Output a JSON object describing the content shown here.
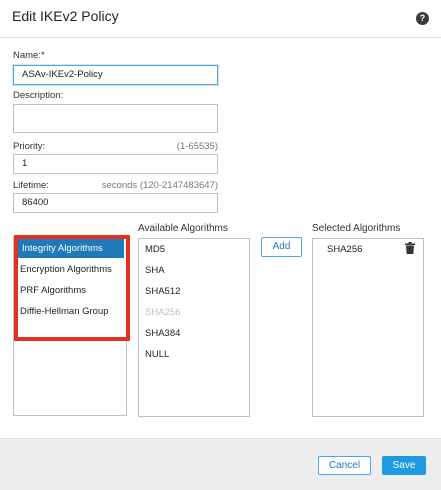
{
  "dialog": {
    "title": "Edit IKEv2 Policy",
    "help_icon_glyph": "?"
  },
  "form": {
    "name_label": "Name:*",
    "name_value": "ASAv-IKEv2-Policy",
    "description_label": "Description:",
    "description_value": "",
    "priority_label": "Priority:",
    "priority_hint": "(1-65535)",
    "priority_value": "1",
    "lifetime_label": "Lifetime:",
    "lifetime_hint": "seconds (120-2147483647)",
    "lifetime_value": "86400"
  },
  "categories": {
    "items": [
      {
        "label": "Integrity Algorithms",
        "selected": true
      },
      {
        "label": "Encryption Algorithms"
      },
      {
        "label": "PRF Algorithms"
      },
      {
        "label": "Diffie-Hellman Group"
      }
    ],
    "highlight_color": "#e03123"
  },
  "available": {
    "title": "Available Algorithms",
    "items": [
      {
        "label": "MD5"
      },
      {
        "label": "SHA"
      },
      {
        "label": "SHA512"
      },
      {
        "label": "SHA256",
        "disabled": true
      },
      {
        "label": "SHA384"
      },
      {
        "label": "NULL"
      }
    ]
  },
  "add_button_label": "Add",
  "selected": {
    "title": "Selected Algorithms",
    "items": [
      {
        "label": "SHA256"
      }
    ]
  },
  "footer": {
    "cancel_label": "Cancel",
    "save_label": "Save"
  },
  "colors": {
    "accent": "#1d9ae0",
    "selected_row": "#1e7ab8",
    "highlight": "#e03123"
  }
}
